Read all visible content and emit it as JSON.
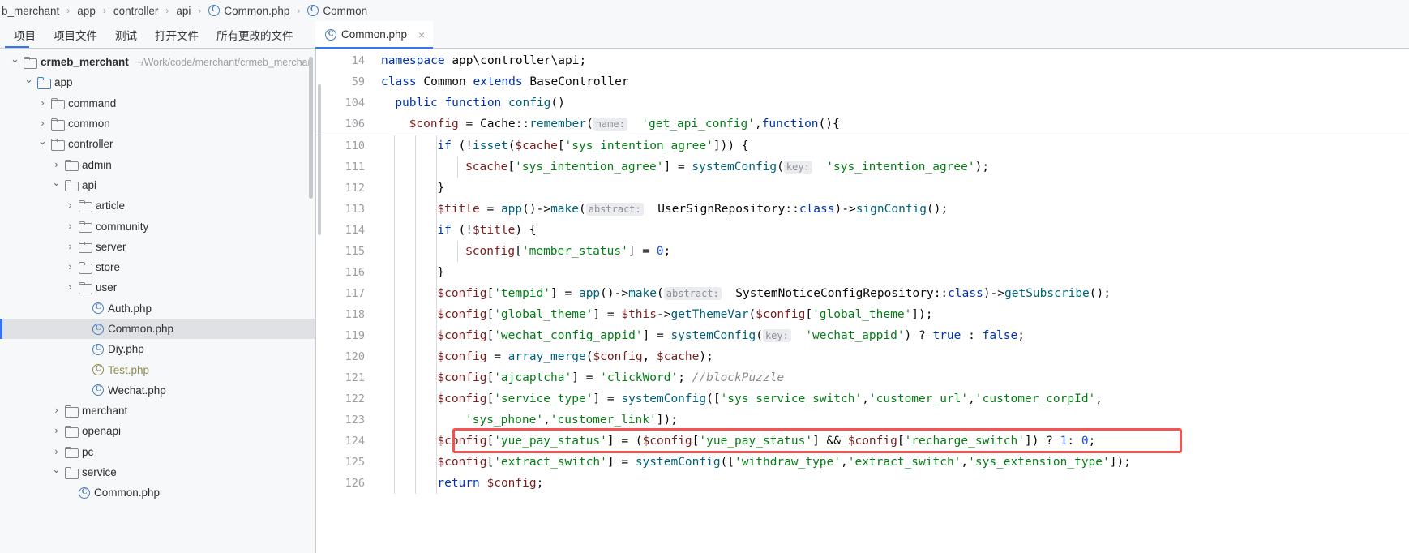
{
  "breadcrumb": {
    "items": [
      {
        "label": "b_merchant",
        "icon": null
      },
      {
        "label": "app",
        "icon": null
      },
      {
        "label": "controller",
        "icon": null
      },
      {
        "label": "api",
        "icon": null
      },
      {
        "label": "Common.php",
        "icon": "php-class-icon"
      },
      {
        "label": "Common",
        "icon": "php-class-icon"
      }
    ],
    "separator": "›"
  },
  "tool_tabs": {
    "items": [
      {
        "label": "项目",
        "active": true
      },
      {
        "label": "项目文件",
        "active": false
      },
      {
        "label": "测试",
        "active": false
      },
      {
        "label": "打开文件",
        "active": false
      },
      {
        "label": "所有更改的文件",
        "active": false
      }
    ]
  },
  "editor_tabs": {
    "items": [
      {
        "label": "Common.php",
        "icon": "php-class-icon",
        "active": true,
        "close": "×"
      }
    ]
  },
  "tree": {
    "rows": [
      {
        "indent": 0,
        "arrow": "⌄",
        "type": "folder",
        "label": "crmeb_merchant",
        "bold": true,
        "path": "~/Work/code/merchant/crmeb_merchan"
      },
      {
        "indent": 1,
        "arrow": "⌄",
        "type": "folder-blue",
        "label": "app",
        "bold": false,
        "path": ""
      },
      {
        "indent": 2,
        "arrow": "›",
        "type": "folder",
        "label": "command",
        "bold": false,
        "path": ""
      },
      {
        "indent": 2,
        "arrow": "›",
        "type": "folder",
        "label": "common",
        "bold": false,
        "path": ""
      },
      {
        "indent": 2,
        "arrow": "⌄",
        "type": "folder",
        "label": "controller",
        "bold": false,
        "path": ""
      },
      {
        "indent": 3,
        "arrow": "›",
        "type": "folder",
        "label": "admin",
        "bold": false,
        "path": ""
      },
      {
        "indent": 3,
        "arrow": "⌄",
        "type": "folder",
        "label": "api",
        "bold": false,
        "path": ""
      },
      {
        "indent": 4,
        "arrow": "›",
        "type": "folder",
        "label": "article",
        "bold": false,
        "path": ""
      },
      {
        "indent": 4,
        "arrow": "›",
        "type": "folder",
        "label": "community",
        "bold": false,
        "path": ""
      },
      {
        "indent": 4,
        "arrow": "›",
        "type": "folder",
        "label": "server",
        "bold": false,
        "path": ""
      },
      {
        "indent": 4,
        "arrow": "›",
        "type": "folder",
        "label": "store",
        "bold": false,
        "path": ""
      },
      {
        "indent": 4,
        "arrow": "›",
        "type": "folder",
        "label": "user",
        "bold": false,
        "path": ""
      },
      {
        "indent": 5,
        "arrow": "",
        "type": "php-class",
        "label": "Auth.php",
        "bold": false,
        "path": ""
      },
      {
        "indent": 5,
        "arrow": "",
        "type": "php-class",
        "label": "Common.php",
        "bold": false,
        "path": "",
        "selected": true
      },
      {
        "indent": 5,
        "arrow": "",
        "type": "php-class",
        "label": "Diy.php",
        "bold": false,
        "path": ""
      },
      {
        "indent": 5,
        "arrow": "",
        "type": "php-class",
        "label": "Test.php",
        "bold": false,
        "path": "",
        "olive": true
      },
      {
        "indent": 5,
        "arrow": "",
        "type": "php-class",
        "label": "Wechat.php",
        "bold": false,
        "path": ""
      },
      {
        "indent": 3,
        "arrow": "›",
        "type": "folder",
        "label": "merchant",
        "bold": false,
        "path": ""
      },
      {
        "indent": 3,
        "arrow": "›",
        "type": "folder",
        "label": "openapi",
        "bold": false,
        "path": ""
      },
      {
        "indent": 3,
        "arrow": "›",
        "type": "folder",
        "label": "pc",
        "bold": false,
        "path": ""
      },
      {
        "indent": 3,
        "arrow": "⌄",
        "type": "folder",
        "label": "service",
        "bold": false,
        "path": ""
      },
      {
        "indent": 4,
        "arrow": "",
        "type": "php-class",
        "label": "Common.php",
        "bold": false,
        "path": ""
      }
    ]
  },
  "code": {
    "sticky": [
      {
        "num": "14",
        "text": "namespace app\\controller\\api;"
      },
      {
        "num": "59",
        "text": "class Common extends BaseController"
      },
      {
        "num": "104",
        "text": "public function config()"
      },
      {
        "num": "106",
        "text": "$config = Cache::remember( name: 'get_api_config',function(){"
      }
    ],
    "lines": [
      {
        "num": "110",
        "text": "if (!isset($cache['sys_intention_agree'])) {"
      },
      {
        "num": "111",
        "text": "$cache['sys_intention_agree'] = systemConfig( key: 'sys_intention_agree');"
      },
      {
        "num": "112",
        "text": "}"
      },
      {
        "num": "113",
        "text": "$title = app()->make( abstract: UserSignRepository::class)->signConfig();"
      },
      {
        "num": "114",
        "text": "if (!$title) {"
      },
      {
        "num": "115",
        "text": "$config['member_status'] = 0;"
      },
      {
        "num": "116",
        "text": "}"
      },
      {
        "num": "117",
        "text": "$config['tempid'] = app()->make( abstract: SystemNoticeConfigRepository::class)->getSubscribe();"
      },
      {
        "num": "118",
        "text": "$config['global_theme'] = $this->getThemeVar($config['global_theme']);"
      },
      {
        "num": "119",
        "text": "$config['wechat_config_appid'] = systemConfig( key: 'wechat_appid') ? true : false;"
      },
      {
        "num": "120",
        "text": "$config = array_merge($config, $cache);"
      },
      {
        "num": "121",
        "text": "$config['ajcaptcha'] = 'clickWord'; //blockPuzzle"
      },
      {
        "num": "122",
        "text": "$config['service_type'] = systemConfig(['sys_service_switch','customer_url','customer_corpId',"
      },
      {
        "num": "123",
        "text": "'sys_phone','customer_link']);"
      },
      {
        "num": "124",
        "text": "$config['yue_pay_status'] = ($config['yue_pay_status'] && $config['recharge_switch']) ? 1: 0;",
        "highlighted": true
      },
      {
        "num": "125",
        "text": "$config['extract_switch'] = systemConfig(['withdraw_type','extract_switch','sys_extension_type']);"
      },
      {
        "num": "126",
        "text": "return $config;"
      }
    ],
    "annotation": {
      "target_line": "124",
      "color": "#f4544f"
    }
  },
  "colors": {
    "accent": "#3574f0",
    "selection": "#dfe1e5",
    "keyword": "#0033b3",
    "string": "#067d17",
    "variable": "#7a1f1f",
    "function": "#00627a",
    "comment": "#8c8c8c",
    "number": "#1750eb",
    "annotation": "#f4544f",
    "olive_file": "#8c8a4a"
  }
}
